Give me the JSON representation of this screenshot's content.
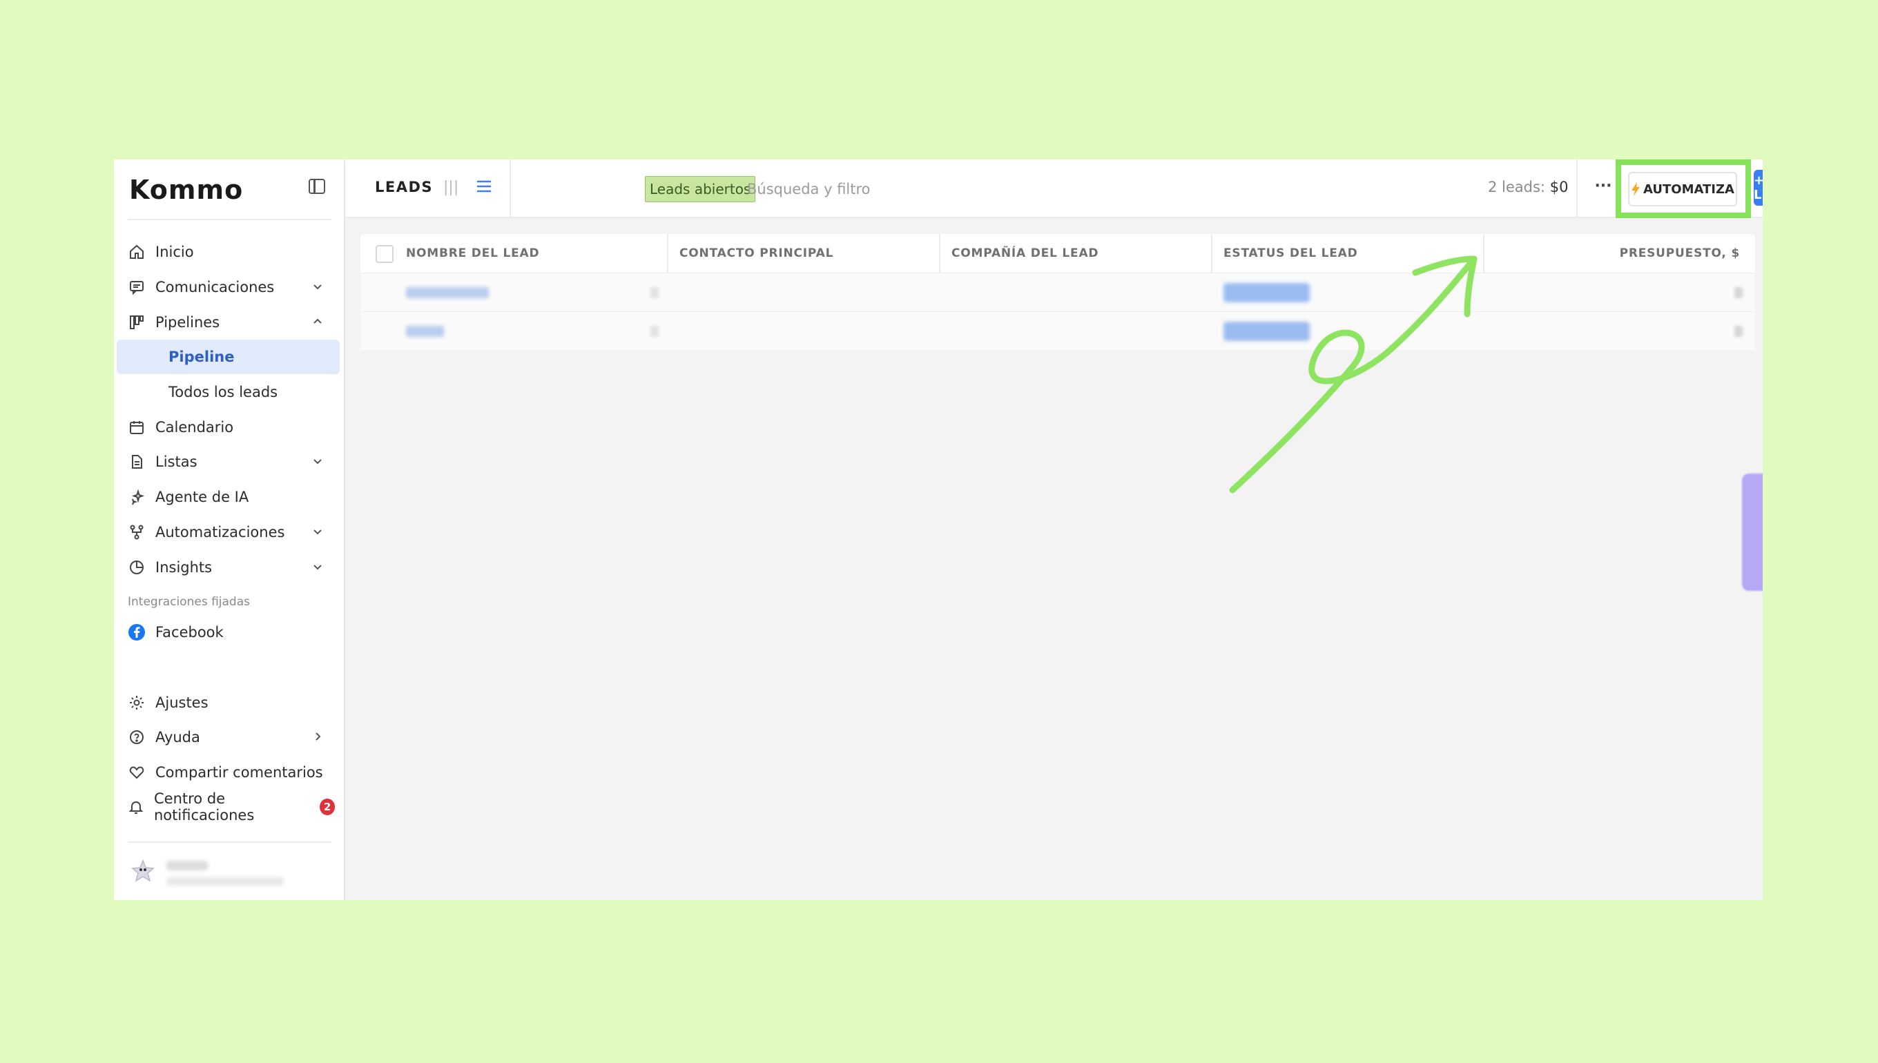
{
  "brand": {
    "logo": "Kommo"
  },
  "sidebar": {
    "items": [
      {
        "label": "Inicio",
        "icon": "home-icon"
      },
      {
        "label": "Comunicaciones",
        "icon": "chat-icon"
      },
      {
        "label": "Pipelines",
        "icon": "pipeline-icon"
      },
      {
        "label": "Pipeline"
      },
      {
        "label": "Todos los leads"
      },
      {
        "label": "Calendario",
        "icon": "calendar-icon"
      },
      {
        "label": "Listas",
        "icon": "document-icon"
      },
      {
        "label": "Agente de IA",
        "icon": "sparkle-icon"
      },
      {
        "label": "Automatizaciones",
        "icon": "flow-icon"
      },
      {
        "label": "Insights",
        "icon": "pie-chart-icon"
      }
    ],
    "section_label": "Integraciones fijadas",
    "facebook": "Facebook",
    "bottom": [
      {
        "label": "Ajustes",
        "icon": "gear-icon"
      },
      {
        "label": "Ayuda",
        "icon": "help-icon"
      },
      {
        "label": "Compartir comentarios",
        "icon": "heart-icon"
      },
      {
        "label": "Centro de notificaciones",
        "icon": "bell-icon",
        "badge": "2"
      }
    ]
  },
  "header": {
    "title": "LEADS",
    "filter_chip": "Leads abiertos",
    "search_placeholder": "Búsqueda y filtro",
    "count_label": "2 leads:",
    "count_value": "$0",
    "more": "···",
    "automate_label": "AUTOMATIZA",
    "new_lead_label": "+ NUEVO LEAD"
  },
  "table": {
    "columns": [
      "NOMBRE DEL LEAD",
      "CONTACTO PRINCIPAL",
      "COMPAÑÍA DEL LEAD",
      "ESTATUS DEL LEAD",
      "PRESUPUESTO, $"
    ]
  },
  "colors": {
    "page_bg": "#e0fbbd",
    "accent": "#3a7ff0",
    "highlight": "#86e25a",
    "badge": "#e0303a"
  }
}
